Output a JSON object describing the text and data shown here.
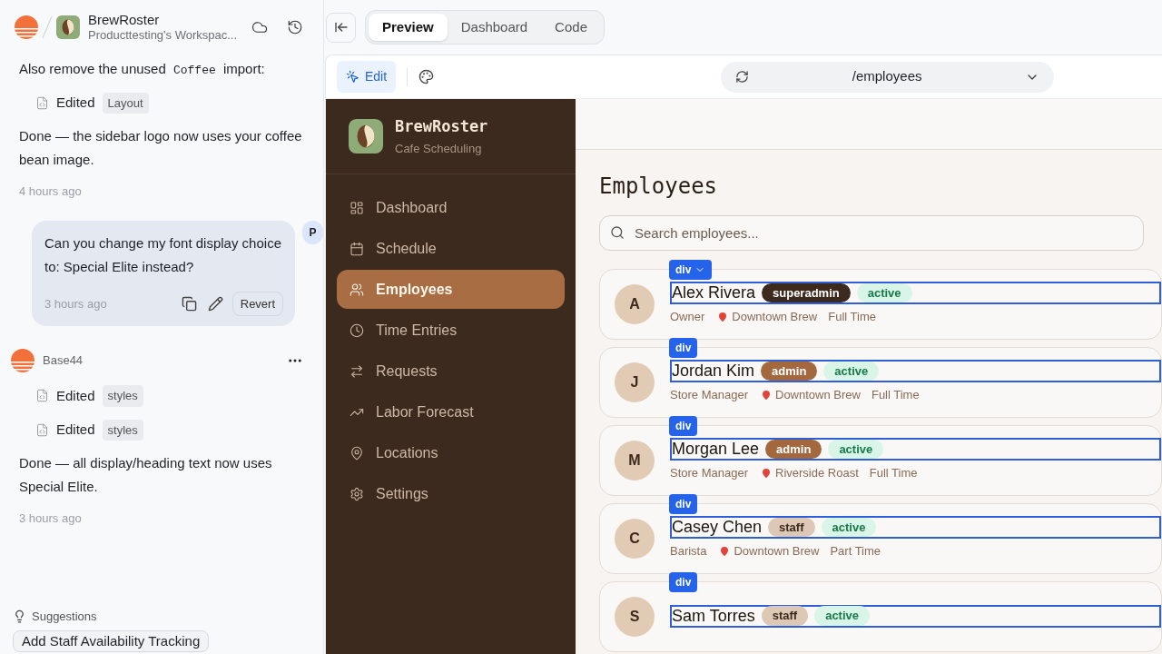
{
  "chat": {
    "project": {
      "name": "BrewRoster",
      "workspace": "Producttesting's Workspac..."
    },
    "feed": [
      {
        "kind": "code_text",
        "parts": [
          "Also remove the unused",
          "Coffee",
          "import:"
        ]
      },
      {
        "kind": "edit",
        "label": "Edited",
        "file": "Layout"
      },
      {
        "kind": "text",
        "text": "Done — the sidebar logo now uses your coffee bean image."
      },
      {
        "kind": "time",
        "text": "4 hours ago"
      },
      {
        "kind": "user",
        "text": "Can you change my font display choice to: Special Elite instead?",
        "time": "3 hours ago",
        "avatar": "P",
        "action": "Revert"
      },
      {
        "kind": "agent",
        "name": "Base44"
      },
      {
        "kind": "edit",
        "label": "Edited",
        "file": "styles"
      },
      {
        "kind": "edit",
        "label": "Edited",
        "file": "styles"
      },
      {
        "kind": "text",
        "text": "Done — all display/heading text now uses Special Elite."
      },
      {
        "kind": "time",
        "text": "3 hours ago"
      }
    ],
    "suggestions": {
      "title": "Suggestions",
      "items": [
        "Add Staff Availability Tracking"
      ]
    }
  },
  "view_tabs": [
    {
      "label": "Preview",
      "selected": true
    },
    {
      "label": "Dashboard",
      "selected": false
    },
    {
      "label": "Code",
      "selected": false
    }
  ],
  "toolbar": {
    "edit": {
      "label": "Edit",
      "selected": true
    },
    "url": "/employees"
  },
  "app": {
    "brand": {
      "name": "BrewRoster",
      "tagline": "Cafe Scheduling"
    },
    "nav": [
      {
        "label": "Dashboard",
        "selected": false
      },
      {
        "label": "Schedule",
        "selected": false
      },
      {
        "label": "Employees",
        "selected": true
      },
      {
        "label": "Time Entries",
        "selected": false
      },
      {
        "label": "Requests",
        "selected": false
      },
      {
        "label": "Labor Forecast",
        "selected": false
      },
      {
        "label": "Locations",
        "selected": false
      },
      {
        "label": "Settings",
        "selected": false
      }
    ],
    "page_title": "Employees",
    "search": {
      "placeholder": "Search employees..."
    },
    "employees": [
      {
        "initial": "A",
        "name": "Alex Rivera",
        "role": {
          "label": "superadmin",
          "kind": "superadmin"
        },
        "status": "active",
        "title": "Owner",
        "location": "Downtown Brew",
        "type": "Full Time",
        "inspector": {
          "tag": "div",
          "dropdown": true
        }
      },
      {
        "initial": "J",
        "name": "Jordan Kim",
        "role": {
          "label": "admin",
          "kind": "admin"
        },
        "status": "active",
        "title": "Store Manager",
        "location": "Downtown Brew",
        "type": "Full Time",
        "inspector": {
          "tag": "div",
          "dropdown": false
        }
      },
      {
        "initial": "M",
        "name": "Morgan Lee",
        "role": {
          "label": "admin",
          "kind": "admin"
        },
        "status": "active",
        "title": "Store Manager",
        "location": "Riverside Roast",
        "type": "Full Time",
        "inspector": {
          "tag": "div",
          "dropdown": false
        }
      },
      {
        "initial": "C",
        "name": "Casey Chen",
        "role": {
          "label": "staff",
          "kind": "staff"
        },
        "status": "active",
        "title": "Barista",
        "location": "Downtown Brew",
        "type": "Part Time",
        "inspector": {
          "tag": "div",
          "dropdown": false
        }
      },
      {
        "initial": "S",
        "name": "Sam Torres",
        "role": {
          "label": "staff",
          "kind": "staff"
        },
        "status": "active",
        "inspector": {
          "tag": "div",
          "dropdown": false
        }
      }
    ]
  }
}
